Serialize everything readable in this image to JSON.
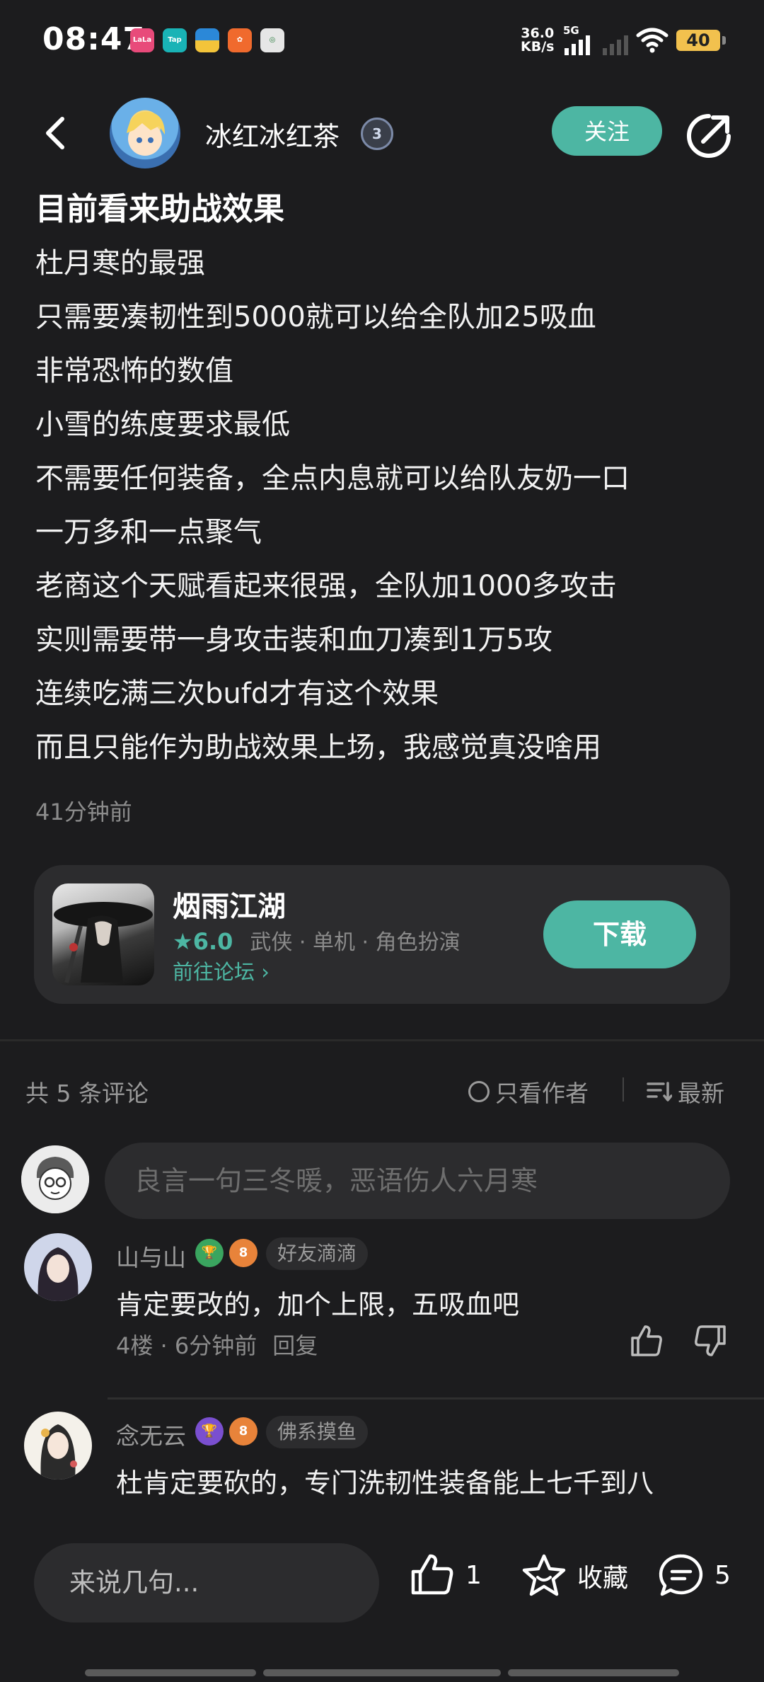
{
  "status_bar": {
    "time": "08:47",
    "net_speed_value": "36.0",
    "net_speed_unit": "KB/s",
    "network": "5G",
    "battery": "40"
  },
  "header": {
    "username": "冰红冰红茶",
    "level_badge": "3",
    "follow_label": "关注"
  },
  "post": {
    "title": "目前看来助战效果",
    "lines": [
      "杜月寒的最强",
      "只需要凑韧性到5000就可以给全队加25吸血",
      "非常恐怖的数值",
      "小雪的练度要求最低",
      "不需要任何装备，全点内息就可以给队友奶一口",
      "一万多和一点聚气",
      "老商这个天赋看起来很强，全队加1000多攻击",
      "实则需要带一身攻击装和血刀凑到1万5攻",
      "连续吃满三次bufd才有这个效果",
      "而且只能作为助战效果上场，我感觉真没啥用"
    ],
    "time": "41分钟前"
  },
  "game_card": {
    "name": "烟雨江湖",
    "rating": "6.0",
    "tags": "武侠 · 单机 · 角色扮演",
    "forum_link": "前往论坛",
    "download_label": "下载"
  },
  "comments_header": {
    "count": "共 5 条评论",
    "author_only": "只看作者",
    "sort": "最新"
  },
  "comment_input": {
    "placeholder": "良言一句三冬暖，恶语伤人六月寒"
  },
  "comments": [
    {
      "name": "山与山",
      "badge_level": "8",
      "tag": "好友滴滴",
      "text": "肯定要改的，加个上限，五吸血吧",
      "floor": "4楼 · 6分钟前",
      "reply": "回复"
    },
    {
      "name": "念无云",
      "badge_level": "8",
      "tag": "佛系摸鱼",
      "text": "杜肯定要砍的，专门洗韧性装备能上七千到八"
    }
  ],
  "bottom_bar": {
    "input_placeholder": "来说几句...",
    "like_count": "1",
    "favorite_label": "收藏",
    "comment_count": "5"
  },
  "colors": {
    "accent": "#4db6a3",
    "background": "#1c1c1e",
    "card": "#2c2c2e"
  }
}
